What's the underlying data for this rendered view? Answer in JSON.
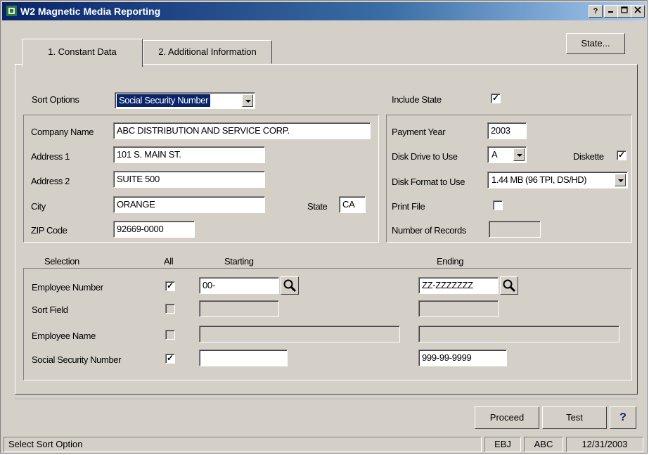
{
  "window": {
    "title": "W2 Magnetic Media Reporting",
    "help_glyph": "?"
  },
  "toolbar": {
    "state_button": "State..."
  },
  "tabs": [
    {
      "label": "1. Constant Data",
      "active": true
    },
    {
      "label": "2. Additional Information",
      "active": false
    }
  ],
  "sort": {
    "label": "Sort Options",
    "value": "Social Security Number"
  },
  "include_state": {
    "label": "Include State",
    "checked": true
  },
  "company": {
    "name_label": "Company Name",
    "name_value": "ABC DISTRIBUTION AND SERVICE CORP.",
    "addr1_label": "Address 1",
    "addr1_value": "101 S. MAIN ST.",
    "addr2_label": "Address 2",
    "addr2_value": "SUITE 500",
    "city_label": "City",
    "city_value": "ORANGE",
    "state_label": "State",
    "state_value": "CA",
    "zip_label": "ZIP Code",
    "zip_value": "92669-0000"
  },
  "media": {
    "payment_year_label": "Payment Year",
    "payment_year_value": "2003",
    "disk_drive_label": "Disk Drive to Use",
    "disk_drive_value": "A",
    "diskette_label": "Diskette",
    "diskette_checked": true,
    "disk_format_label": "Disk Format to Use",
    "disk_format_value": "1.44 MB (96 TPI, DS/HD)",
    "print_file_label": "Print File",
    "print_file_checked": false,
    "records_label": "Number of Records",
    "records_value": ""
  },
  "selection": {
    "headers": {
      "selection": "Selection",
      "all": "All",
      "starting": "Starting",
      "ending": "Ending"
    },
    "rows": [
      {
        "label": "Employee Number",
        "all": true,
        "starting": "00-",
        "ending": "ZZ-ZZZZZZZ"
      },
      {
        "label": "Sort Field",
        "all": false,
        "starting": "",
        "ending": ""
      },
      {
        "label": "Employee Name",
        "all": false,
        "starting": "",
        "ending": ""
      },
      {
        "label": "Social Security Number",
        "all": true,
        "starting": "",
        "ending": "999-99-9999"
      }
    ]
  },
  "buttons": {
    "proceed": "Proceed",
    "test": "Test",
    "help": "?"
  },
  "status": {
    "message": "Select Sort Option",
    "user": "EBJ",
    "company": "ABC",
    "date": "12/31/2003"
  },
  "colors": {
    "face": "#d4d0c8",
    "title_start": "#0a246a",
    "title_end": "#a6caf0",
    "highlight": "#0a246a"
  }
}
